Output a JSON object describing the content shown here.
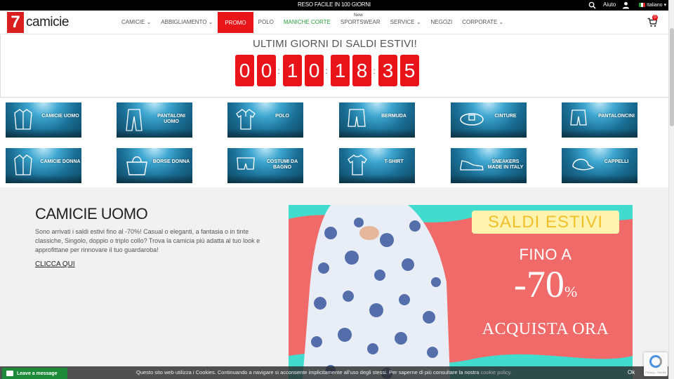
{
  "topbar": {
    "promo_text": "RESO FACILE IN 100 GIORNI",
    "help_label": "Aiuto",
    "language_label": "Italiano"
  },
  "brand": {
    "logo_number": "7",
    "logo_word": "camicie"
  },
  "nav": {
    "items": [
      {
        "label": "CAMICIE",
        "dropdown": true
      },
      {
        "label": "ABBIGLIAMENTO",
        "dropdown": true
      },
      {
        "label": "PROMO",
        "style": "promo"
      },
      {
        "label": "POLO"
      },
      {
        "label": "MANICHE CORTE",
        "style": "green"
      },
      {
        "label": "SPORTSWEAR",
        "badge": "New"
      },
      {
        "label": "SERVICE",
        "dropdown": true
      },
      {
        "label": "NEGOZI"
      },
      {
        "label": "CORPORATE",
        "dropdown": true
      }
    ],
    "cart_count": "0"
  },
  "countdown": {
    "title": "ULTIMI GIORNI DI SALDI ESTIVI!",
    "digits": [
      "0",
      "0",
      "1",
      "0",
      "1",
      "8",
      "3",
      "5"
    ]
  },
  "categories": [
    {
      "label": "CAMICIE UOMO",
      "icon": "shirt-icon"
    },
    {
      "label": "PANTALONI UOMO",
      "icon": "trousers-icon"
    },
    {
      "label": "POLO",
      "icon": "polo-icon"
    },
    {
      "label": "BERMUDA",
      "icon": "bermuda-icon"
    },
    {
      "label": "CINTURE",
      "icon": "belt-icon"
    },
    {
      "label": "PANTALONCINI",
      "icon": "shorts-icon"
    },
    {
      "label": "CAMICIE DONNA",
      "icon": "blouse-icon"
    },
    {
      "label": "BORSE DONNA",
      "icon": "bag-icon"
    },
    {
      "label": "COSTUMI DA BAGNO",
      "icon": "swimsuit-icon"
    },
    {
      "label": "T-SHIRT",
      "icon": "tshirt-icon"
    },
    {
      "label": "SNEAKERS MADE IN ITALY",
      "icon": "sneaker-icon"
    },
    {
      "label": "CAPPELLI",
      "icon": "cap-icon"
    }
  ],
  "main": {
    "heading": "CAMICIE UOMO",
    "description": "Sono arrivati i saldi estivi fino al -70%! Casual o eleganti, a fantasia o in tinte classiche, Singolo, doppio o triplo collo? Trova la camicia più adatta al tuo look e approfittane per rinnovare il tuo guardaroba!",
    "cta": "CLICCA QUI"
  },
  "banner": {
    "tag": "SALDI ESTIVI",
    "line1": "FINO A",
    "discount": "-70",
    "discount_unit": "%",
    "action": "ACQUISTA ORA"
  },
  "cookie": {
    "message": "Questo sito web utilizza i Cookies. Continuando a navigare si acconsente implicitamente all'uso degli stessi. Per saperne di più consultare la nostra",
    "link": "cookie policy.",
    "ok": "Ok"
  },
  "chat": {
    "label": "Leave a message"
  },
  "recaptcha": {
    "text": "Privacy - Termini"
  },
  "colors": {
    "accent": "#e8141a",
    "green": "#2a9d3b",
    "banner_teal": "#42dccf",
    "banner_coral": "#f06a6a"
  }
}
